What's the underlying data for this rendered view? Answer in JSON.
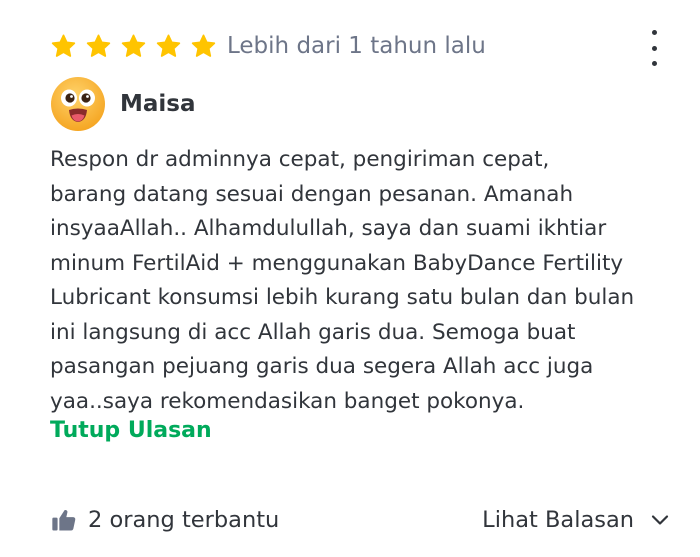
{
  "review": {
    "rating": 5,
    "rating_max": 5,
    "time_ago": "Lebih dari 1 tahun lalu",
    "user": {
      "name": "Maisa",
      "avatar_icon": "surprised-face-emoji-icon"
    },
    "text_lines": [
      "Respon dr adminnya cepat, pengiriman cepat,",
      "barang datang sesuai dengan pesanan. Amanah",
      "insyaaAllah.. Alhamdulullah, saya dan suami ikhtiar",
      "minum FertilAid + menggunakan BabyDance Fertility",
      "Lubricant konsumsi lebih kurang satu bulan dan bulan",
      "ini langsung di acc Allah garis dua. Semoga buat",
      "pasangan pejuang garis dua segera Allah acc juga",
      "yaa..saya rekomendasikan banget pokonya."
    ],
    "toggle_label": "Tutup Ulasan",
    "helpful_label": "2 orang terbantu",
    "replies_label": "Lihat Balasan"
  },
  "colors": {
    "star": "#ffc400",
    "link_green": "#00aa5b",
    "text": "#31353b",
    "muted": "#6d7588",
    "icon_gray": "#6d7588"
  },
  "icons": {
    "star": "star-icon",
    "more": "more-vertical-icon",
    "helpful": "thumbs-up-icon",
    "expand": "chevron-down-icon"
  }
}
